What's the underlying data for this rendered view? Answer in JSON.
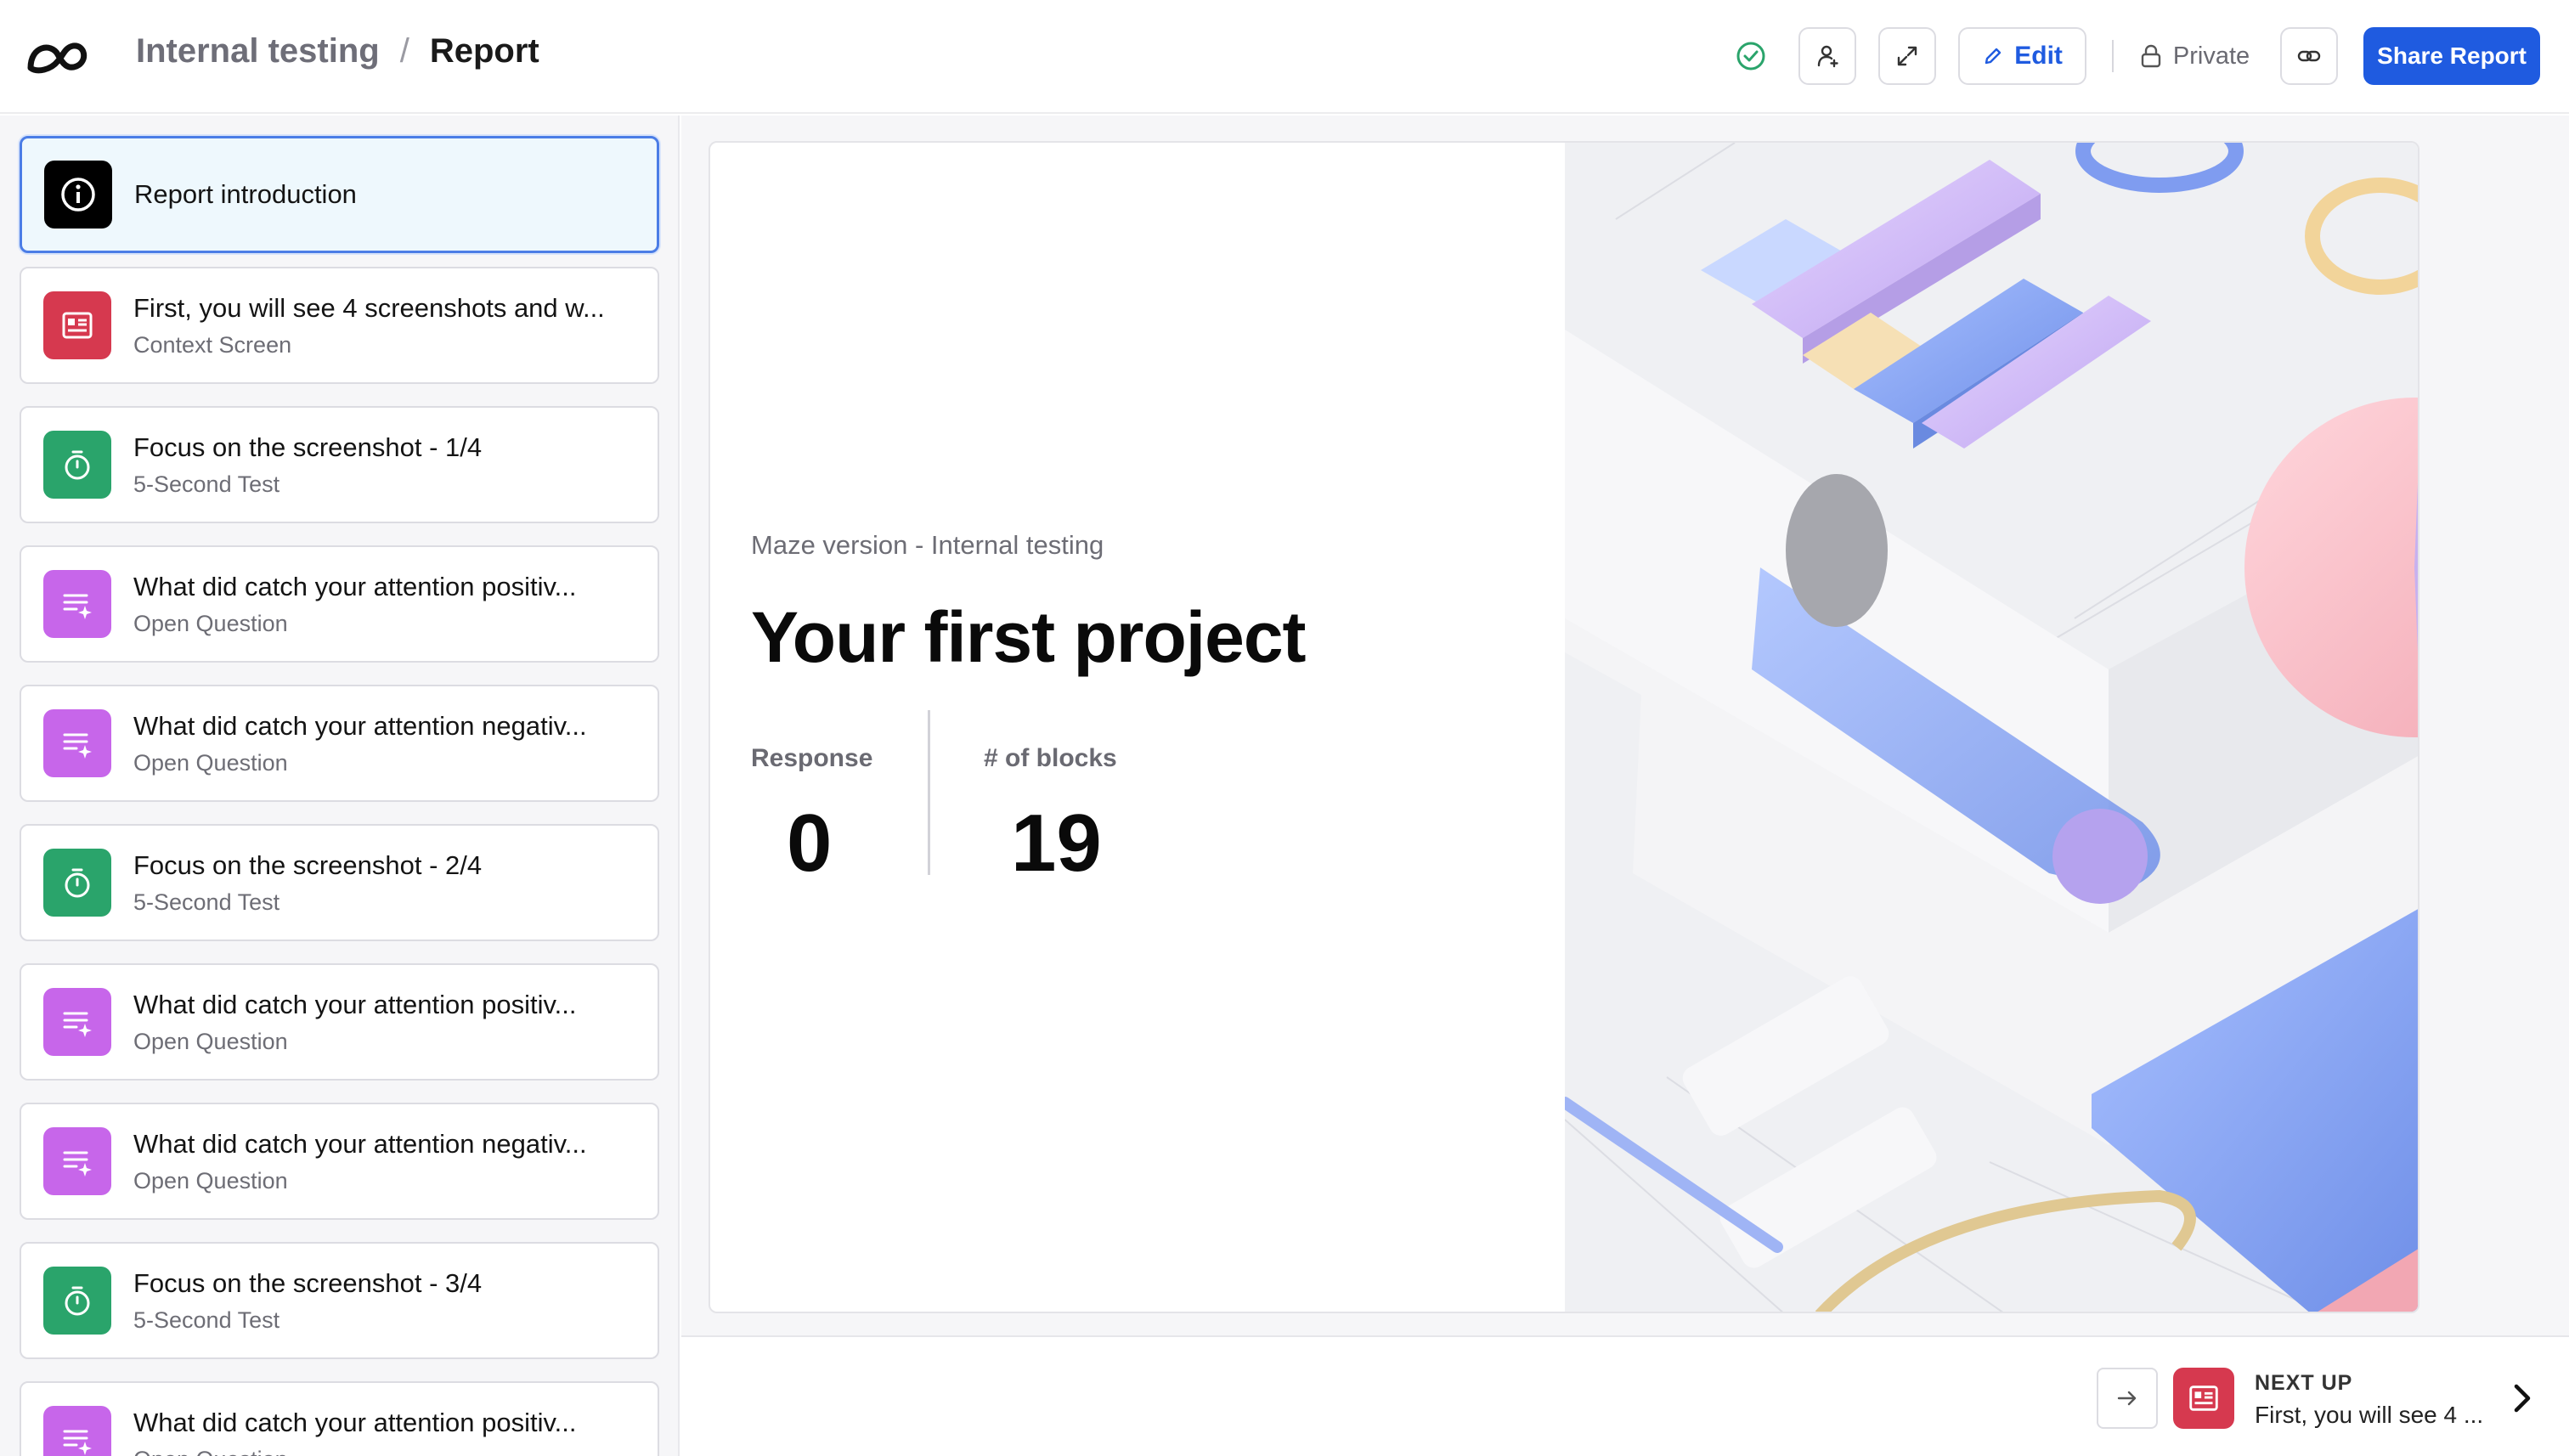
{
  "header": {
    "project_name": "Internal testing",
    "separator": "/",
    "page_name": "Report",
    "edit_label": "Edit",
    "privacy_label": "Private",
    "share_label": "Share Report"
  },
  "sidebar": {
    "blocks": [
      {
        "title": "Report introduction",
        "subtitle": "",
        "icon": "info-icon",
        "color": "#000000"
      },
      {
        "title": "First, you will see 4 screenshots and w...",
        "subtitle": "Context Screen",
        "icon": "context-screen-icon",
        "color": "#d6394f"
      },
      {
        "title": "Focus on the screenshot - 1/4",
        "subtitle": "5-Second Test",
        "icon": "timer-icon",
        "color": "#2aa46b"
      },
      {
        "title": "What did catch your attention positiv...",
        "subtitle": "Open Question",
        "icon": "open-question-icon",
        "color": "#c766ea"
      },
      {
        "title": "What did catch your attention negativ...",
        "subtitle": "Open Question",
        "icon": "open-question-icon",
        "color": "#c766ea"
      },
      {
        "title": "Focus on the screenshot - 2/4",
        "subtitle": "5-Second Test",
        "icon": "timer-icon",
        "color": "#2aa46b"
      },
      {
        "title": "What did catch your attention positiv...",
        "subtitle": "Open Question",
        "icon": "open-question-icon",
        "color": "#c766ea"
      },
      {
        "title": "What did catch your attention negativ...",
        "subtitle": "Open Question",
        "icon": "open-question-icon",
        "color": "#c766ea"
      },
      {
        "title": "Focus on the screenshot - 3/4",
        "subtitle": "5-Second Test",
        "icon": "timer-icon",
        "color": "#2aa46b"
      },
      {
        "title": "What did catch your attention positiv...",
        "subtitle": "Open Question",
        "icon": "open-question-icon",
        "color": "#c766ea"
      }
    ]
  },
  "intro": {
    "version_label": "Maze version - Internal testing",
    "title": "Your first project",
    "response_label": "Response",
    "response_value": "0",
    "blocks_label": "# of blocks",
    "blocks_value": "19"
  },
  "footer": {
    "next_label": "NEXT UP",
    "next_title": "First, you will see 4 ..."
  },
  "colors": {
    "accent": "#1f5be0",
    "active_border": "#4b7de6",
    "context_red": "#d6394f",
    "test_green": "#2aa46b",
    "question_purple": "#c766ea"
  }
}
